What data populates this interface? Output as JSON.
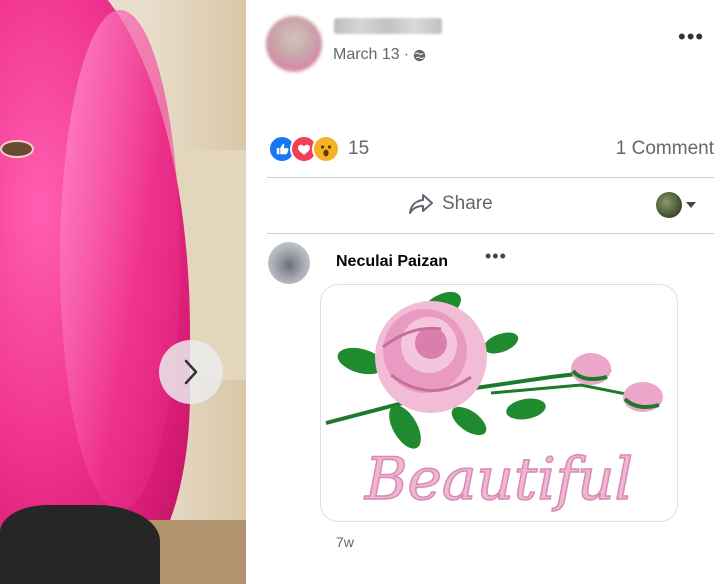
{
  "post": {
    "date": "March 13",
    "date_separator": "·",
    "more_label": "•••",
    "reaction_count": "15",
    "comments_label": "1 Comment",
    "share_label": "Share"
  },
  "comment": {
    "author": "Neculai Paizan",
    "more_label": "•••",
    "sticker_text": "Beautiful",
    "time": "7w"
  },
  "icons": {
    "next": "chevron-right-icon",
    "globe": "globe-icon",
    "like": "like-icon",
    "love": "love-icon",
    "wow": "wow-icon",
    "share": "share-arrow-icon"
  },
  "colors": {
    "like": "#1877f2",
    "love": "#f33e58",
    "wow": "#f7b125",
    "secondary_text": "#65676b",
    "hair_pink": "#f0348f"
  }
}
